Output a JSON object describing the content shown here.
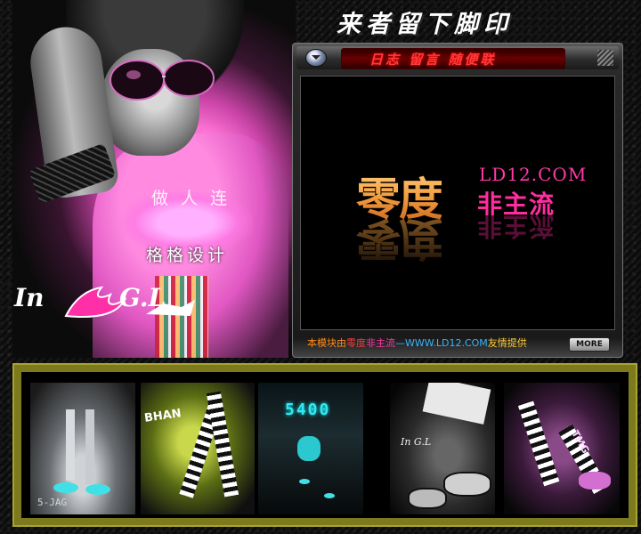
{
  "header": {
    "title": "来者留下脚印"
  },
  "hero": {
    "caption_top": "做 人 连",
    "caption_bottom": "格格设计",
    "logo_left": "In",
    "logo_right": "G.L"
  },
  "panel": {
    "tabs_label": "日志 留言 随便联",
    "brand_main": "零度",
    "brand_url": "LD12.COM",
    "brand_sub": "非主流",
    "credit": {
      "part1": "本模块由",
      "part2": "零度",
      "part3": "非主流",
      "part4": "—WWW.LD12.COM",
      "part5": "友情提供"
    },
    "more_label": "MORE"
  },
  "thumbnails": {
    "t1_label": "5-JAG",
    "t2_label": "BHAN",
    "t3_label": "5400",
    "t4_label": "In G.L",
    "t5_label": "TMG"
  },
  "colors": {
    "accent_pink": "#ff2d9e",
    "accent_orange": "#f4a040",
    "frame_olive": "#7d7a1e",
    "tab_red": "#ff3a3a"
  }
}
